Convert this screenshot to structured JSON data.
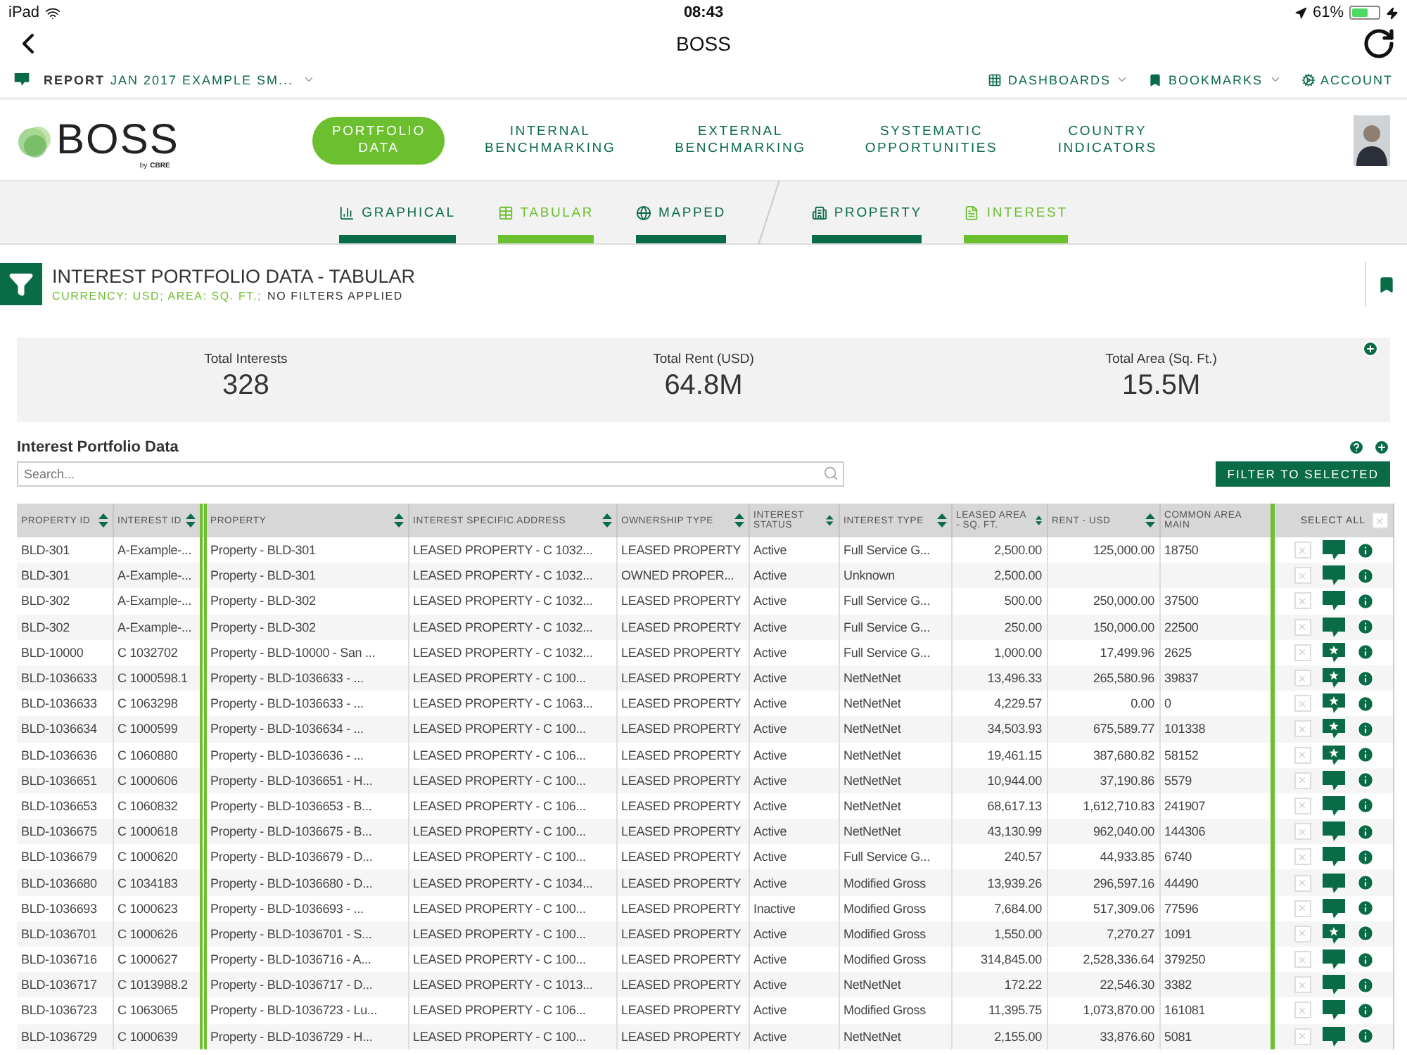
{
  "status_bar": {
    "device": "iPad",
    "time": "08:43",
    "battery": "61%"
  },
  "nav": {
    "title": "BOSS"
  },
  "report_bar": {
    "label": "REPORT",
    "value": "JAN 2017 EXAMPLE SM...",
    "links": [
      {
        "label": "DASHBOARDS",
        "kind": "grid",
        "dropdown": true
      },
      {
        "label": "BOOKMARKS",
        "kind": "bookmark",
        "dropdown": true
      },
      {
        "label": "ACCOUNT",
        "kind": "gears",
        "dropdown": false
      }
    ]
  },
  "logo": {
    "text": "BOSS",
    "by": "by",
    "brand": "CBRE"
  },
  "main_tabs": [
    {
      "label": "PORTFOLIO\nDATA",
      "selected": true
    },
    {
      "label": "INTERNAL\nBENCHMARKING",
      "selected": false
    },
    {
      "label": "EXTERNAL\nBENCHMARKING",
      "selected": false
    },
    {
      "label": "SYSTEMATIC\nOPPORTUNITIES",
      "selected": false
    },
    {
      "label": "COUNTRY\nINDICATORS",
      "selected": false
    }
  ],
  "view_tabs": [
    {
      "label": "GRAPHICAL",
      "kind": "chart",
      "selected": false
    },
    {
      "label": "TABULAR",
      "kind": "table",
      "selected": true
    },
    {
      "label": "MAPPED",
      "kind": "globe",
      "selected": false
    }
  ],
  "level_tabs": [
    {
      "label": "PROPERTY",
      "kind": "building",
      "selected": false
    },
    {
      "label": "INTEREST",
      "kind": "document",
      "selected": true
    }
  ],
  "page_header": {
    "title": "INTEREST PORTFOLIO DATA - TABULAR",
    "filters_info": "CURRENCY: USD;  AREA: SQ. FT.;",
    "filters_status": "NO FILTERS APPLIED"
  },
  "summary": [
    {
      "label": "Total Interests",
      "value": "328"
    },
    {
      "label": "Total Rent (USD)",
      "value": "64.8M"
    },
    {
      "label": "Total Area (Sq. Ft.)",
      "value": "15.5M"
    }
  ],
  "section": {
    "title": "Interest Portfolio Data",
    "search_placeholder": "Search...",
    "filter_button": "FILTER TO SELECTED"
  },
  "table": {
    "columns": [
      {
        "label": "PROPERTY ID",
        "sortable": true
      },
      {
        "label": "INTEREST ID",
        "sortable": true
      },
      {
        "label": "PROPERTY",
        "sortable": true
      },
      {
        "label": "INTEREST SPECIFIC ADDRESS",
        "sortable": true
      },
      {
        "label": "OWNERSHIP TYPE",
        "sortable": true
      },
      {
        "label": "INTEREST STATUS",
        "sortable": true
      },
      {
        "label": "INTEREST TYPE",
        "sortable": true
      },
      {
        "label": "LEASED AREA - SQ. FT.",
        "sortable": true
      },
      {
        "label": "RENT - USD",
        "sortable": true
      },
      {
        "label": "COMMON AREA MAIN",
        "sortable": false
      }
    ],
    "select_all": "SELECT ALL",
    "select_all_checked": false,
    "rows": [
      {
        "cells": [
          "BLD-301",
          "A-Example-...",
          "Property - BLD-301",
          "LEASED PROPERTY - C 1032...",
          "LEASED PROPERTY",
          "Active",
          "Full Service G...",
          "2,500.00",
          "125,000.00",
          "18750"
        ],
        "starred": false,
        "checked": false
      },
      {
        "cells": [
          "BLD-301",
          "A-Example-...",
          "Property - BLD-301",
          "LEASED PROPERTY - C 1032...",
          "OWNED PROPER...",
          "Active",
          "Unknown",
          "2,500.00"
        ],
        "starred": false,
        "checked": false
      },
      {
        "cells": [
          "BLD-302",
          "A-Example-...",
          "Property - BLD-302",
          "LEASED PROPERTY - C 1032...",
          "LEASED PROPERTY",
          "Active",
          "Full Service G...",
          "500.00",
          "250,000.00",
          "37500"
        ],
        "starred": false,
        "checked": false
      },
      {
        "cells": [
          "BLD-302",
          "A-Example-...",
          "Property - BLD-302",
          "LEASED PROPERTY - C 1032...",
          "LEASED PROPERTY",
          "Active",
          "Full Service G...",
          "250.00",
          "150,000.00",
          "22500"
        ],
        "starred": false,
        "checked": false
      },
      {
        "cells": [
          "BLD-10000",
          "C 1032702",
          "Property - BLD-10000 - San ...",
          "LEASED PROPERTY - C 1032...",
          "LEASED PROPERTY",
          "Active",
          "Full Service G...",
          "1,000.00",
          "17,499.96",
          "2625"
        ],
        "starred": true,
        "checked": false
      },
      {
        "cells": [
          "BLD-1036633",
          "C 1000598.1",
          "Property - BLD-1036633 - ...",
          "LEASED PROPERTY - C 100...",
          "LEASED PROPERTY",
          "Active",
          "NetNetNet",
          "13,496.33",
          "265,580.96",
          "39837"
        ],
        "starred": true,
        "checked": false
      },
      {
        "cells": [
          "BLD-1036633",
          "C 1063298",
          "Property - BLD-1036633 - ...",
          "LEASED PROPERTY - C 1063...",
          "LEASED PROPERTY",
          "Active",
          "NetNetNet",
          "4,229.57",
          "0.00",
          "0"
        ],
        "starred": true,
        "checked": false
      },
      {
        "cells": [
          "BLD-1036634",
          "C 1000599",
          "Property - BLD-1036634 - ...",
          "LEASED PROPERTY - C 100...",
          "LEASED PROPERTY",
          "Active",
          "NetNetNet",
          "34,503.93",
          "675,589.77",
          "101338"
        ],
        "starred": true,
        "checked": false
      },
      {
        "cells": [
          "BLD-1036636",
          "C 1060880",
          "Property - BLD-1036636 - ...",
          "LEASED PROPERTY - C 106...",
          "LEASED PROPERTY",
          "Active",
          "NetNetNet",
          "19,461.15",
          "387,680.82",
          "58152"
        ],
        "starred": true,
        "checked": false
      },
      {
        "cells": [
          "BLD-1036651",
          "C 1000606",
          "Property - BLD-1036651 - H...",
          "LEASED PROPERTY - C 100...",
          "LEASED PROPERTY",
          "Active",
          "NetNetNet",
          "10,944.00",
          "37,190.86",
          "5579"
        ],
        "starred": false,
        "checked": false
      },
      {
        "cells": [
          "BLD-1036653",
          "C 1060832",
          "Property - BLD-1036653 - B...",
          "LEASED PROPERTY - C 106...",
          "LEASED PROPERTY",
          "Active",
          "NetNetNet",
          "68,617.13",
          "1,612,710.83",
          "241907"
        ],
        "starred": false,
        "checked": false
      },
      {
        "cells": [
          "BLD-1036675",
          "C 1000618",
          "Property - BLD-1036675 - B...",
          "LEASED PROPERTY - C 100...",
          "LEASED PROPERTY",
          "Active",
          "NetNetNet",
          "43,130.99",
          "962,040.00",
          "144306"
        ],
        "starred": false,
        "checked": false
      },
      {
        "cells": [
          "BLD-1036679",
          "C 1000620",
          "Property - BLD-1036679 - D...",
          "LEASED PROPERTY - C 100...",
          "LEASED PROPERTY",
          "Active",
          "Full Service G...",
          "240.57",
          "44,933.85",
          "6740"
        ],
        "starred": false,
        "checked": false
      },
      {
        "cells": [
          "BLD-1036680",
          "C 1034183",
          "Property - BLD-1036680 - D...",
          "LEASED PROPERTY - C 1034...",
          "LEASED PROPERTY",
          "Active",
          "Modified Gross",
          "13,939.26",
          "296,597.16",
          "44490"
        ],
        "starred": false,
        "checked": false
      },
      {
        "cells": [
          "BLD-1036693",
          "C 1000623",
          "Property - BLD-1036693 - ...",
          "LEASED PROPERTY - C 100...",
          "LEASED PROPERTY",
          "Inactive",
          "Modified Gross",
          "7,684.00",
          "517,309.06",
          "77596"
        ],
        "starred": false,
        "checked": false
      },
      {
        "cells": [
          "BLD-1036701",
          "C 1000626",
          "Property - BLD-1036701 - S...",
          "LEASED PROPERTY - C 100...",
          "LEASED PROPERTY",
          "Active",
          "Modified Gross",
          "1,550.00",
          "7,270.27",
          "1091"
        ],
        "starred": true,
        "checked": false
      },
      {
        "cells": [
          "BLD-1036716",
          "C 1000627",
          "Property - BLD-1036716 - A...",
          "LEASED PROPERTY - C 100...",
          "LEASED PROPERTY",
          "Active",
          "Modified Gross",
          "314,845.00",
          "2,528,336.64",
          "379250"
        ],
        "starred": false,
        "checked": false
      },
      {
        "cells": [
          "BLD-1036717",
          "C 1013988.2",
          "Property - BLD-1036717 - D...",
          "LEASED PROPERTY - C 1013...",
          "LEASED PROPERTY",
          "Active",
          "NetNetNet",
          "172.22",
          "22,546.30",
          "3382"
        ],
        "starred": false,
        "checked": false
      },
      {
        "cells": [
          "BLD-1036723",
          "C 1063065",
          "Property - BLD-1036723 - Lu...",
          "LEASED PROPERTY - C 106...",
          "LEASED PROPERTY",
          "Active",
          "Modified Gross",
          "11,395.75",
          "1,073,870.00",
          "161081"
        ],
        "starred": false,
        "checked": false
      },
      {
        "cells": [
          "BLD-1036729",
          "C 1000639",
          "Property - BLD-1036729 - H...",
          "LEASED PROPERTY - C 100...",
          "LEASED PROPERTY",
          "Active",
          "NetNetNet",
          "2,155.00",
          "33,876.60",
          "5081"
        ],
        "starred": false,
        "checked": false
      }
    ]
  }
}
